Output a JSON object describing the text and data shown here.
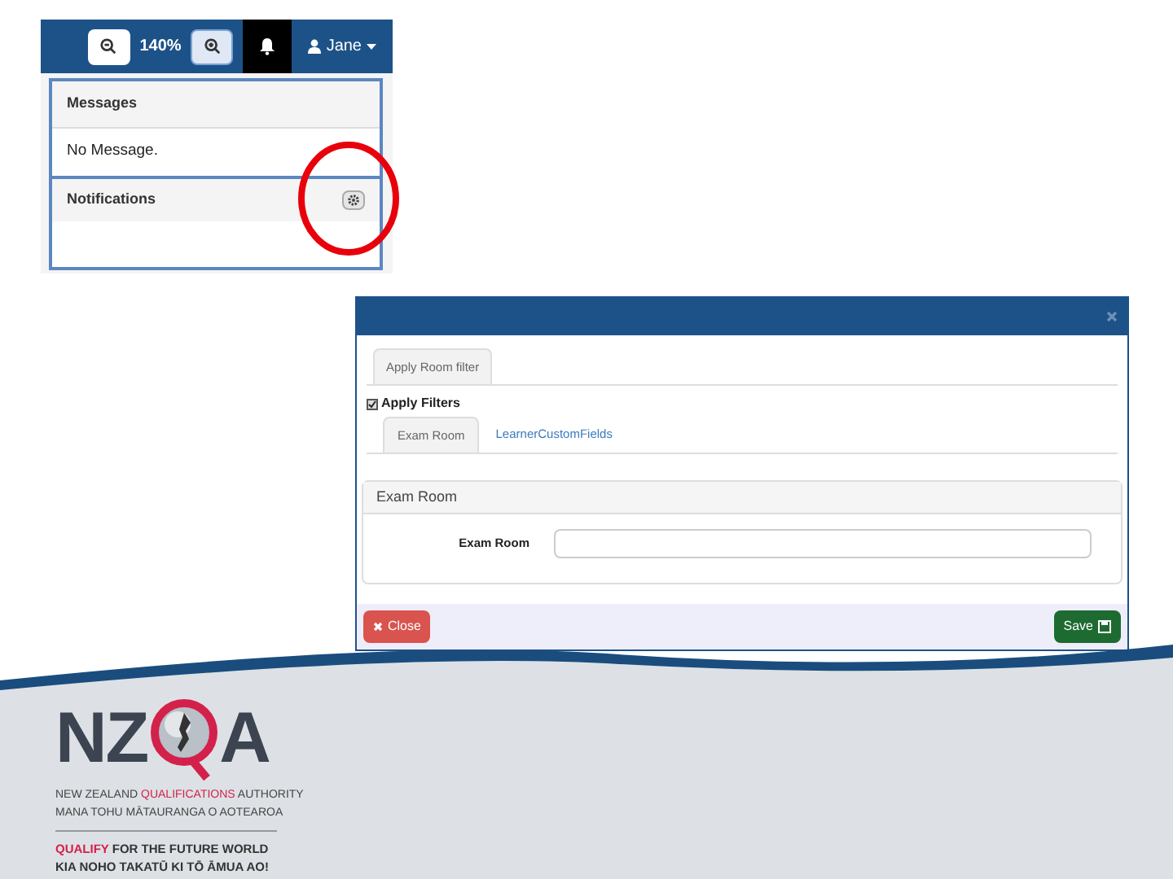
{
  "toolbar": {
    "zoom": "140%",
    "user": "Jane"
  },
  "dropdown": {
    "sections": [
      {
        "title": "Messages",
        "body": "No Message.",
        "settings": false
      },
      {
        "title": "Notifications",
        "settings": true
      }
    ]
  },
  "dialog": {
    "tabs": [
      {
        "label": "Apply Room filter",
        "selected": true
      }
    ],
    "apply_filters": {
      "label": "Apply Filters",
      "checked": true
    },
    "subtabs": [
      {
        "label": "Exam Room",
        "selected": true
      },
      {
        "label": "LearnerCustomFields",
        "selected": false
      }
    ],
    "panel": {
      "title": "Exam Room",
      "field_label": "Exam Room"
    },
    "buttons": [
      {
        "kind": "danger",
        "label": "Close"
      },
      {
        "kind": "success",
        "label": "Save"
      }
    ]
  },
  "logo": {
    "left": "NZ",
    "right": "A",
    "line_1": [
      {
        "text": "NEW ZEALAND ",
        "accent": false
      },
      {
        "text": "QUALIFICATIONS",
        "accent": true
      },
      {
        "text": " AUTHORITY",
        "accent": false
      }
    ],
    "line_2": [
      {
        "text": "MANA TOHU MĀTAURANGA O AOTEAROA",
        "accent": false
      }
    ],
    "line_3": [
      {
        "text": "QUALIFY",
        "accent": true
      },
      {
        "text": " FOR THE FUTURE WORLD",
        "accent": false
      }
    ],
    "line_4": [
      {
        "text": "KIA NOHO TAKATŪ KI TŌ ĀMUA AO!",
        "accent": false
      }
    ]
  }
}
